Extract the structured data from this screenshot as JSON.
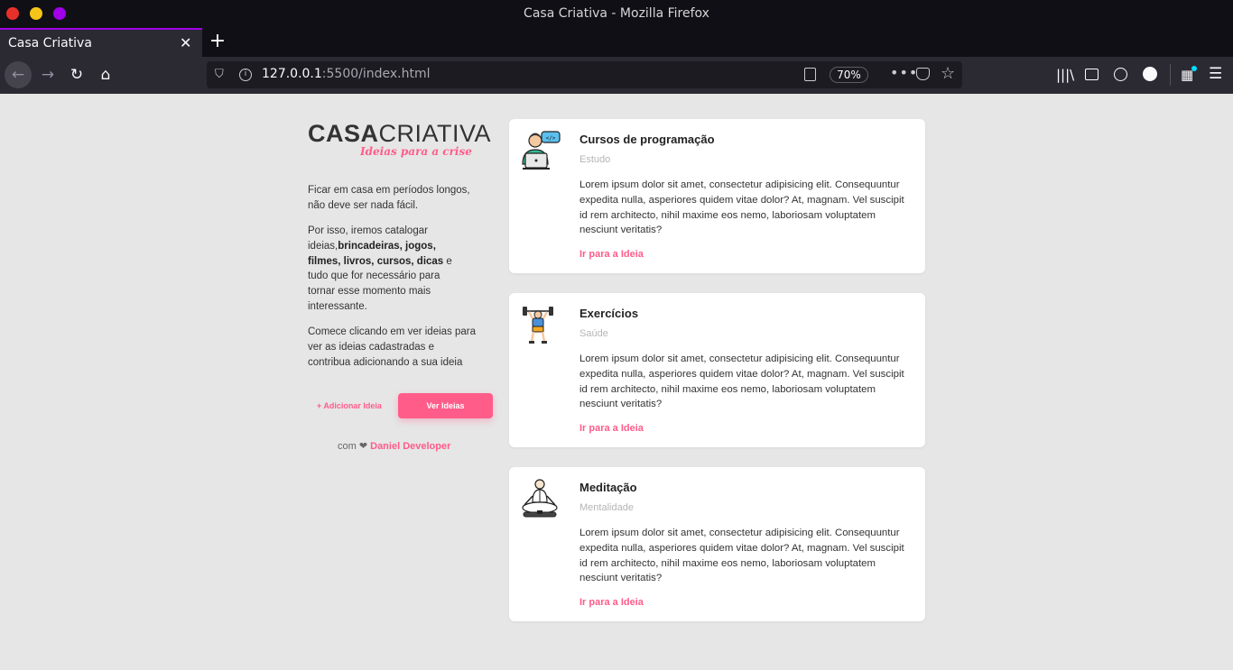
{
  "browser": {
    "window_title": "Casa Criativa - Mozilla Firefox",
    "tab_title": "Casa Criativa",
    "url_host": "127.0.0.1",
    "url_rest": ":5500/index.html",
    "zoom": "70%",
    "accent_color": "#a100e8"
  },
  "sidebar": {
    "logo_bold": "CASA",
    "logo_light": "CRIATIVA",
    "tagline": "Ideias para a crise",
    "p1": "Ficar em casa em períodos longos, não deve ser nada fácil.",
    "p2_start": "Por isso, iremos catalogar ideias,",
    "p2_bold": "brincadeiras, jogos, filmes, livros, cursos, dicas",
    "p2_end": " e tudo que for necessário para tornar esse momento mais interessante.",
    "p3": "Comece clicando em ver ideias para ver as ideias cadastradas e contribua adicionando a sua ideia",
    "add_button": "+ Adicionar Ideia",
    "view_button": "Ver Ideias",
    "credit_prefix": "com ❤ ",
    "credit_author": "Daniel Developer"
  },
  "cards": [
    {
      "title": "Cursos de programação",
      "category": "Estudo",
      "description": "Lorem ipsum dolor sit amet, consectetur adipisicing elit. Consequuntur expedita nulla, asperiores quidem vitae dolor? At, magnam. Vel suscipit id rem architecto, nihil maxime eos nemo, laboriosam voluptatem nesciunt veritatis?",
      "link": "Ir para a Ideia"
    },
    {
      "title": "Exercícios",
      "category": "Saúde",
      "description": "Lorem ipsum dolor sit amet, consectetur adipisicing elit. Consequuntur expedita nulla, asperiores quidem vitae dolor? At, magnam. Vel suscipit id rem architecto, nihil maxime eos nemo, laboriosam voluptatem nesciunt veritatis?",
      "link": "Ir para a Ideia"
    },
    {
      "title": "Meditação",
      "category": "Mentalidade",
      "description": "Lorem ipsum dolor sit amet, consectetur adipisicing elit. Consequuntur expedita nulla, asperiores quidem vitae dolor? At, magnam. Vel suscipit id rem architecto, nihil maxime eos nemo, laboriosam voluptatem nesciunt veritatis?",
      "link": "Ir para a Ideia"
    }
  ],
  "colors": {
    "brand_pink": "#ff5c8a",
    "page_bg": "#e6e6e6"
  }
}
